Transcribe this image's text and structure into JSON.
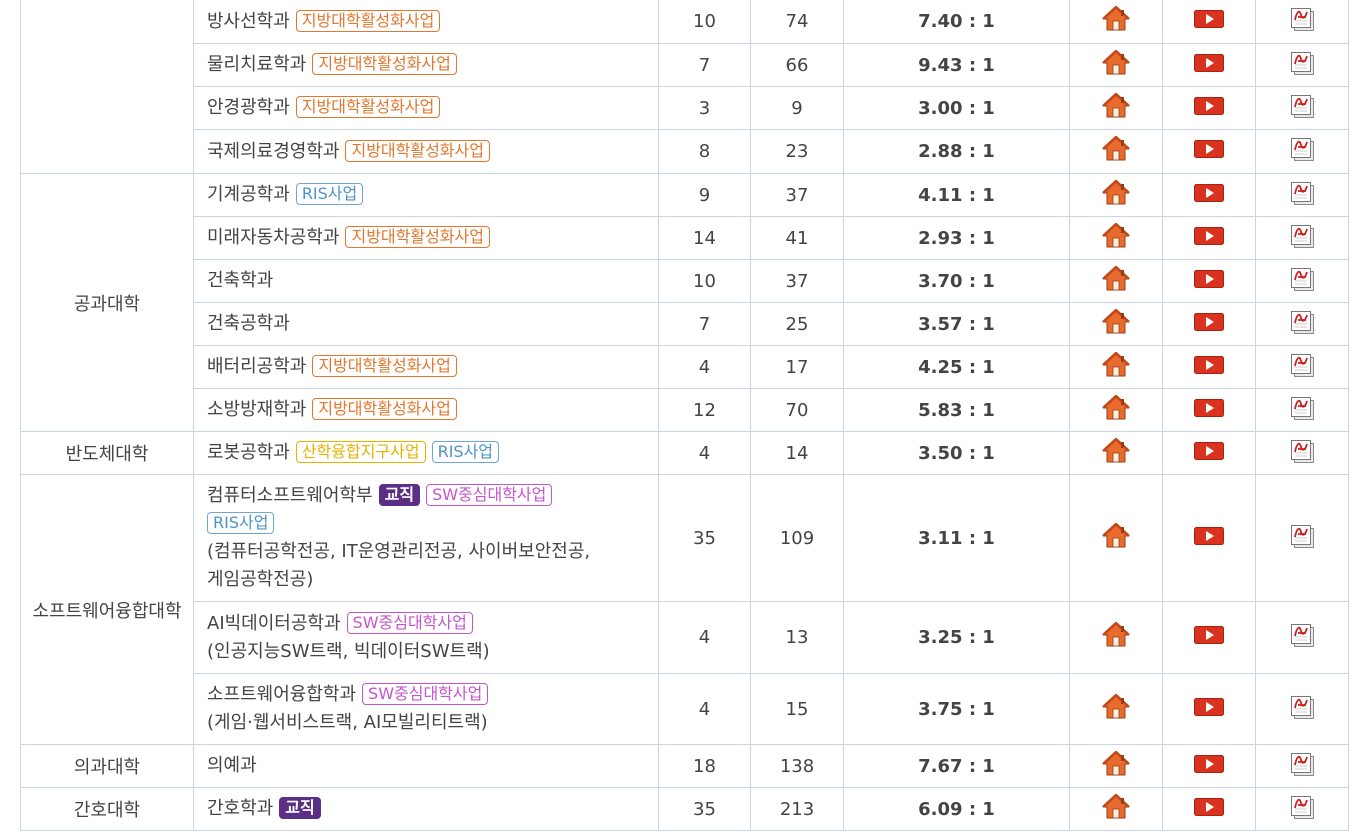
{
  "table": {
    "rows": [
      {
        "college": "",
        "rowspan": 4,
        "dept": "방사선학과",
        "badges": [
          {
            "text": "지방대학활성화사업",
            "type": "regional"
          }
        ],
        "sub": [],
        "recruit": "10",
        "applicants": "74",
        "ratio": "7.40 : 1"
      },
      {
        "dept": "물리치료학과",
        "badges": [
          {
            "text": "지방대학활성화사업",
            "type": "regional"
          }
        ],
        "sub": [],
        "recruit": "7",
        "applicants": "66",
        "ratio": "9.43 : 1"
      },
      {
        "dept": "안경광학과",
        "badges": [
          {
            "text": "지방대학활성화사업",
            "type": "regional"
          }
        ],
        "sub": [],
        "recruit": "3",
        "applicants": "9",
        "ratio": "3.00 : 1"
      },
      {
        "dept": "국제의료경영학과",
        "badges": [
          {
            "text": "지방대학활성화사업",
            "type": "regional"
          }
        ],
        "sub": [],
        "recruit": "8",
        "applicants": "23",
        "ratio": "2.88 : 1"
      },
      {
        "college": "공과대학",
        "rowspan": 6,
        "dept": "기계공학과",
        "badges": [
          {
            "text": "RIS사업",
            "type": "ris"
          }
        ],
        "sub": [],
        "recruit": "9",
        "applicants": "37",
        "ratio": "4.11 : 1"
      },
      {
        "dept": "미래자동차공학과",
        "badges": [
          {
            "text": "지방대학활성화사업",
            "type": "regional"
          }
        ],
        "sub": [],
        "recruit": "14",
        "applicants": "41",
        "ratio": "2.93 : 1"
      },
      {
        "dept": "건축학과",
        "badges": [],
        "sub": [],
        "recruit": "10",
        "applicants": "37",
        "ratio": "3.70 : 1"
      },
      {
        "dept": "건축공학과",
        "badges": [],
        "sub": [],
        "recruit": "7",
        "applicants": "25",
        "ratio": "3.57 : 1"
      },
      {
        "dept": "배터리공학과",
        "badges": [
          {
            "text": "지방대학활성화사업",
            "type": "regional"
          }
        ],
        "sub": [],
        "recruit": "4",
        "applicants": "17",
        "ratio": "4.25 : 1"
      },
      {
        "dept": "소방방재학과",
        "badges": [
          {
            "text": "지방대학활성화사업",
            "type": "regional"
          }
        ],
        "sub": [],
        "recruit": "12",
        "applicants": "70",
        "ratio": "5.83 : 1"
      },
      {
        "college": "반도체대학",
        "rowspan": 1,
        "dept": "로봇공학과",
        "badges": [
          {
            "text": "산학융합지구사업",
            "type": "industry"
          },
          {
            "text": "RIS사업",
            "type": "ris"
          }
        ],
        "sub": [],
        "recruit": "4",
        "applicants": "14",
        "ratio": "3.50 : 1"
      },
      {
        "college": "소프트웨어융합대학",
        "rowspan": 3,
        "dept": "컴퓨터소프트웨어학부",
        "badges": [
          {
            "text": "교직",
            "type": "tenure"
          },
          {
            "text": "SW중심대학사업",
            "type": "sw"
          }
        ],
        "badges2": [
          {
            "text": "RIS사업",
            "type": "ris"
          }
        ],
        "sub": [
          "(컴퓨터공학전공, IT운영관리전공, 사이버보안전공,",
          "게임공학전공)"
        ],
        "recruit": "35",
        "applicants": "109",
        "ratio": "3.11 : 1"
      },
      {
        "dept": "AI빅데이터공학과",
        "badges": [
          {
            "text": "SW중심대학사업",
            "type": "sw"
          }
        ],
        "sub": [
          "(인공지능SW트랙, 빅데이터SW트랙)"
        ],
        "recruit": "4",
        "applicants": "13",
        "ratio": "3.25 : 1"
      },
      {
        "dept": "소프트웨어융합학과",
        "badges": [
          {
            "text": "SW중심대학사업",
            "type": "sw"
          }
        ],
        "sub": [
          "(게임·웹서비스트랙, AI모빌리티트랙)"
        ],
        "recruit": "4",
        "applicants": "15",
        "ratio": "3.75 : 1"
      },
      {
        "college": "의과대학",
        "rowspan": 1,
        "dept": "의예과",
        "badges": [],
        "sub": [],
        "recruit": "18",
        "applicants": "138",
        "ratio": "7.67 : 1"
      },
      {
        "college": "간호대학",
        "rowspan": 1,
        "dept": "간호학과",
        "badges": [
          {
            "text": "교직",
            "type": "tenure"
          }
        ],
        "sub": [],
        "recruit": "35",
        "applicants": "213",
        "ratio": "6.09 : 1"
      }
    ],
    "icons": {
      "home": "home-icon",
      "video": "video-icon",
      "pdf": "pdf-icon"
    }
  },
  "colors": {
    "border": "#c9d4e6",
    "regional": "#e2772d",
    "ris": "#4e92cc",
    "industry": "#e8b300",
    "sw": "#c555cf",
    "tenure": "#5a2f85",
    "video_red": "#d9321e",
    "home_orange": "#e86a2c"
  }
}
